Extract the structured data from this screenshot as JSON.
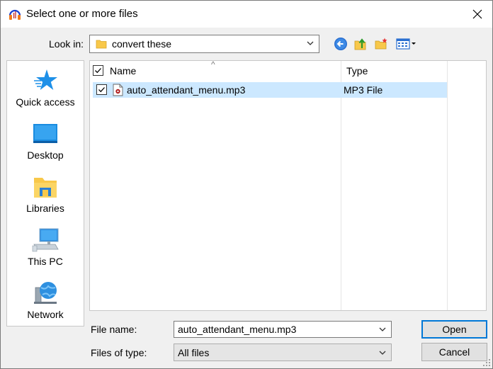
{
  "window": {
    "title": "Select one or more files",
    "close_icon": "close-icon",
    "app_icon": "audacity-headphones-icon"
  },
  "lookin": {
    "label": "Look in:",
    "value": "convert these",
    "icon": "folder-icon"
  },
  "toolbar": {
    "back_icon": "back-arrow-icon",
    "up_icon": "up-folder-icon",
    "new_folder_icon": "new-folder-icon",
    "view_menu_icon": "view-menu-icon"
  },
  "places": [
    {
      "label": "Quick access",
      "icon": "star-icon"
    },
    {
      "label": "Desktop",
      "icon": "desktop-icon"
    },
    {
      "label": "Libraries",
      "icon": "libraries-icon"
    },
    {
      "label": "This PC",
      "icon": "computer-icon"
    },
    {
      "label": "Network",
      "icon": "network-icon"
    }
  ],
  "filelist": {
    "columns": {
      "name": "Name",
      "type": "Type"
    },
    "rows": [
      {
        "name": "auto_attendant_menu.mp3",
        "type": "MP3 File",
        "checked": true,
        "selected": true
      }
    ]
  },
  "filename": {
    "label": "File name:",
    "value": "auto_attendant_menu.mp3"
  },
  "filetype": {
    "label": "Files of type:",
    "value": "All files"
  },
  "buttons": {
    "open": "Open",
    "cancel": "Cancel"
  },
  "colors": {
    "selection": "#cce8ff",
    "accent": "#0078d7",
    "folder": "#f8c84a"
  }
}
